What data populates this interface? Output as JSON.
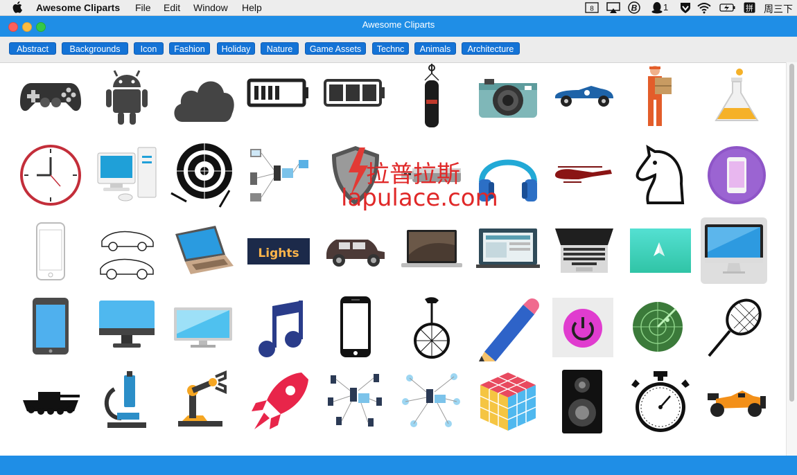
{
  "menubar": {
    "app_name": "Awesome Cliparts",
    "items": [
      "File",
      "Edit",
      "Window",
      "Help"
    ],
    "status_number": "8",
    "qq_count": "1",
    "input_method": "拼",
    "clock": "周三下午"
  },
  "window": {
    "title": "Awesome Cliparts"
  },
  "categories": [
    "Abstract",
    "Backgrounds",
    "Icon",
    "Fashion",
    "Holiday",
    "Nature",
    "Game Assets",
    "Technc",
    "Animals",
    "Architecture"
  ],
  "watermark": {
    "cn": "拉普拉斯",
    "url": "lapulace.com"
  },
  "cliparts": [
    [
      "gamepad-icon",
      "android-icon",
      "cloud-icon",
      "battery-low-icon",
      "battery-high-icon",
      "punching-bag-icon",
      "camera-icon",
      "race-car-icon",
      "delivery-man-icon",
      "flask-icon"
    ],
    [
      "clock-icon",
      "desktop-computer-icon",
      "dartboard-icon",
      "network-diagram-icon",
      "shield-icon",
      "usb-drive-icon",
      "headphones-icon",
      "helicopter-icon",
      "chess-knight-icon",
      "phone-circle-icon"
    ],
    [
      "smartphone-outline-icon",
      "cars-sketch-icon",
      "laptop-icon",
      "lights-sign-icon",
      "vintage-car-icon",
      "macbook-icon",
      "laptop-screen-icon",
      "laptop-keyboard-icon",
      "paper-plane-icon",
      "imac-icon"
    ],
    [
      "tablet-icon",
      "monitor-icon",
      "widescreen-monitor-icon",
      "music-note-icon",
      "iphone-icon",
      "unicycle-icon",
      "pencil-icon",
      "power-button-icon",
      "radar-icon",
      "tennis-racket-icon"
    ],
    [
      "tank-icon",
      "microscope-icon",
      "robot-arm-icon",
      "rocket-icon",
      "server-network-icon",
      "cloud-network-icon",
      "rubiks-cube-icon",
      "speaker-icon",
      "stopwatch-icon",
      "formula-car-icon"
    ]
  ],
  "selected": "imac-icon",
  "lights_text": "Lights"
}
